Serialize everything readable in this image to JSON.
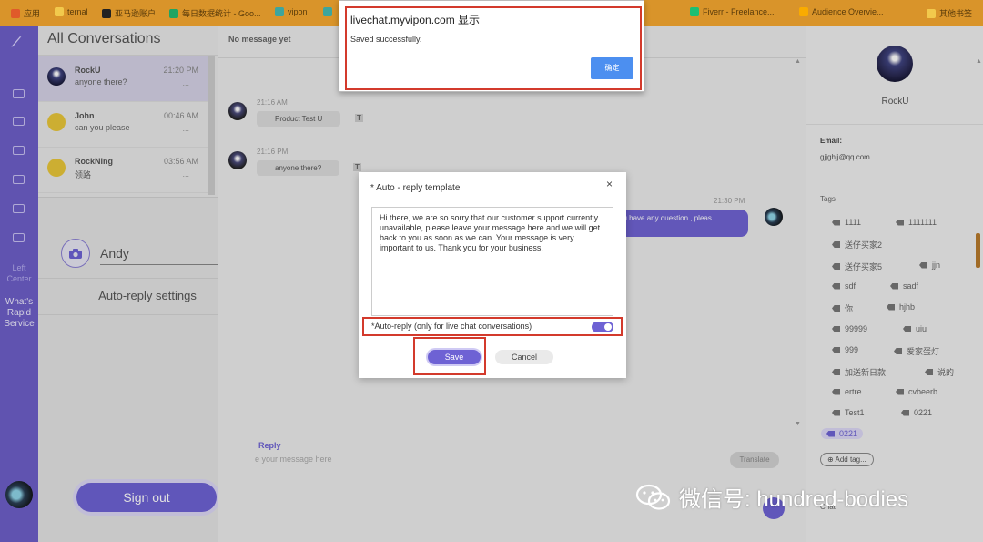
{
  "bookmarks": [
    {
      "label": "应用",
      "color": "#e05a2a"
    },
    {
      "label": "ternal",
      "color": "#f2c94c"
    },
    {
      "label": "亚马逊账户",
      "color": "#222222"
    },
    {
      "label": "每日数据统计 - Goo...",
      "color": "#1fa463"
    },
    {
      "label": "vipon",
      "color": "#3ea59d"
    },
    {
      "label": "v",
      "color": "#3ea59d"
    },
    {
      "label": "Fiverr - Freelance...",
      "color": "#1dbf73"
    },
    {
      "label": "Audience Overvie...",
      "color": "#f9ab00"
    },
    {
      "label": "其他书签",
      "color": "#f2c94c"
    }
  ],
  "leftnav": {
    "texts": [
      "Left Center",
      "What's Rapid Service"
    ]
  },
  "conversations": {
    "title": "All Conversations",
    "items": [
      {
        "name": "RockU",
        "message": "anyone there?",
        "time": "21:20 PM",
        "dots": "...",
        "avatar_color": "#3f4380"
      },
      {
        "name": "John",
        "message": "can you please",
        "time": "00:46 AM",
        "dots": "...",
        "avatar_color": "#e9c73a"
      },
      {
        "name": "RockNing",
        "message": "领路",
        "time": "03:56 AM",
        "dots": "...",
        "avatar_color": "#e9c73a"
      }
    ]
  },
  "settings": {
    "name_value": "Andy",
    "autoreply_label": "Auto-reply settings",
    "signout_label": "Sign out"
  },
  "chat": {
    "header": "No message yet",
    "messages": [
      {
        "time": "21:16 AM",
        "text": "Product Test U",
        "tag": "T"
      },
      {
        "time": "21:16 PM",
        "text": "anyone there?",
        "tag": "T"
      }
    ],
    "outgoing": {
      "time": "21:30 PM",
      "text": "ou have any question , pleas"
    },
    "reply_label": "Reply",
    "reply_placeholder": "e your message here",
    "translate_label": "Translate"
  },
  "profile": {
    "name": "RockU",
    "email_label": "Email:",
    "email": "gjjghjj@qq.com",
    "tags_label": "Tags",
    "tags": [
      "1111",
      "1111111",
      "送仔买家2",
      "送仔买家5",
      "jjn",
      "sdf",
      "sadf",
      "你",
      "hjhb",
      "99999",
      "uiu",
      "999",
      "爱家蛋灯",
      "加送新日款",
      "说的",
      "ertre",
      "cvbeerb",
      "Test1",
      "0221",
      "0221"
    ],
    "add_tag_label": "Add tag...",
    "chat_label": "Chat"
  },
  "alert": {
    "title": "livechat.myvipon.com 显示",
    "message": "Saved successfully.",
    "ok_label": "确定"
  },
  "modal": {
    "title": "* Auto - reply template",
    "close": "×",
    "template_text": "Hi there, we are so sorry that our customer support currently unavailable, please leave your message here and we will get back to you as soon as we can. Your message is very important to us. Thank you for your business.",
    "toggle_label": "*Auto-reply (only for live chat conversations)",
    "toggle_on": true,
    "save_label": "Save",
    "cancel_label": "Cancel"
  },
  "watermark": {
    "text": "微信号: hundred-bodies"
  },
  "colors": {
    "accent": "#6e62d4",
    "highlight": "#d33a2c",
    "bookmark_bar": "#d9942a",
    "left_nav": "#6e5fc9"
  }
}
